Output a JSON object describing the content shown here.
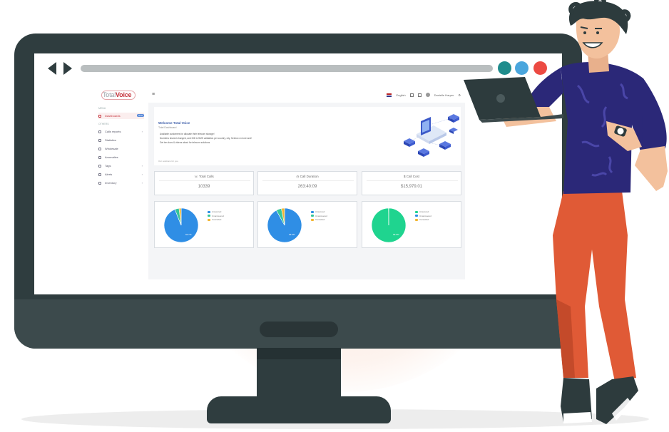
{
  "app": {
    "logo_part1": "Total",
    "logo_part2": "Voice",
    "menu_toggle_icon": "hamburger-icon",
    "language": "English",
    "user_name": "Danielle Harper"
  },
  "sidebar": {
    "section_main": "Menu",
    "section_other": "Others",
    "items": [
      {
        "label": "Dashboards",
        "icon": "dashboard-icon",
        "active": true,
        "badge": "New"
      },
      {
        "label": "Calls reports",
        "icon": "phone-icon",
        "chevron": true
      },
      {
        "label": "Statistics",
        "icon": "chart-icon"
      },
      {
        "label": "Wholesale",
        "icon": "globe-icon"
      },
      {
        "label": "Anomalies",
        "icon": "alert-icon"
      },
      {
        "label": "Tags",
        "icon": "tag-icon",
        "chevron": true
      },
      {
        "label": "Alerts",
        "icon": "bell-icon",
        "chevron": true
      },
      {
        "label": "Inventory",
        "icon": "box-icon",
        "chevron": true
      }
    ]
  },
  "welcome": {
    "title": "Welcome Total Voice",
    "subtitle": "Total Dashboard",
    "bullets": [
      "Available customers for allocate their telecom storage!",
      "Numbers shared changed, and DID & SMS validation per country, city, freebox & more and!",
      "Get ten docs & videos about for telecom solutions"
    ],
    "footer": "Our solutions for you"
  },
  "stats": [
    {
      "label": "Total Calls",
      "value": "10339",
      "icon": "phone-icon"
    },
    {
      "label": "Call Duration",
      "value": "263:40:09",
      "icon": "clock-icon"
    },
    {
      "label": "Call Cost",
      "value": "$15,979.01",
      "icon": "money-icon"
    }
  ],
  "pies": [
    {
      "legend": [
        "Answered",
        "Unanswered",
        "Cancelled"
      ],
      "colors": [
        "#2f8ee5",
        "#35c69a",
        "#f2b632"
      ],
      "slices": [
        0.94,
        0.04,
        0.02
      ],
      "label": "94.7%"
    },
    {
      "legend": [
        "Answered",
        "Unanswered",
        "Cancelled"
      ],
      "colors": [
        "#2f8ee5",
        "#35c69a",
        "#f2b632"
      ],
      "slices": [
        0.92,
        0.05,
        0.03
      ],
      "label": "93.0%"
    },
    {
      "legend": [
        "Answered",
        "Unanswered",
        "Cancelled"
      ],
      "colors": [
        "#1fd48f",
        "#2f8ee5",
        "#f2b632"
      ],
      "slices": [
        0.998,
        0.001,
        0.001
      ],
      "label": "99.9%"
    }
  ],
  "browser": {
    "back_icon": "arrow-left-icon",
    "forward_icon": "arrow-right-icon",
    "window_dots": [
      "#1f8c8c",
      "#4aa6dd",
      "#ec4a42"
    ]
  }
}
